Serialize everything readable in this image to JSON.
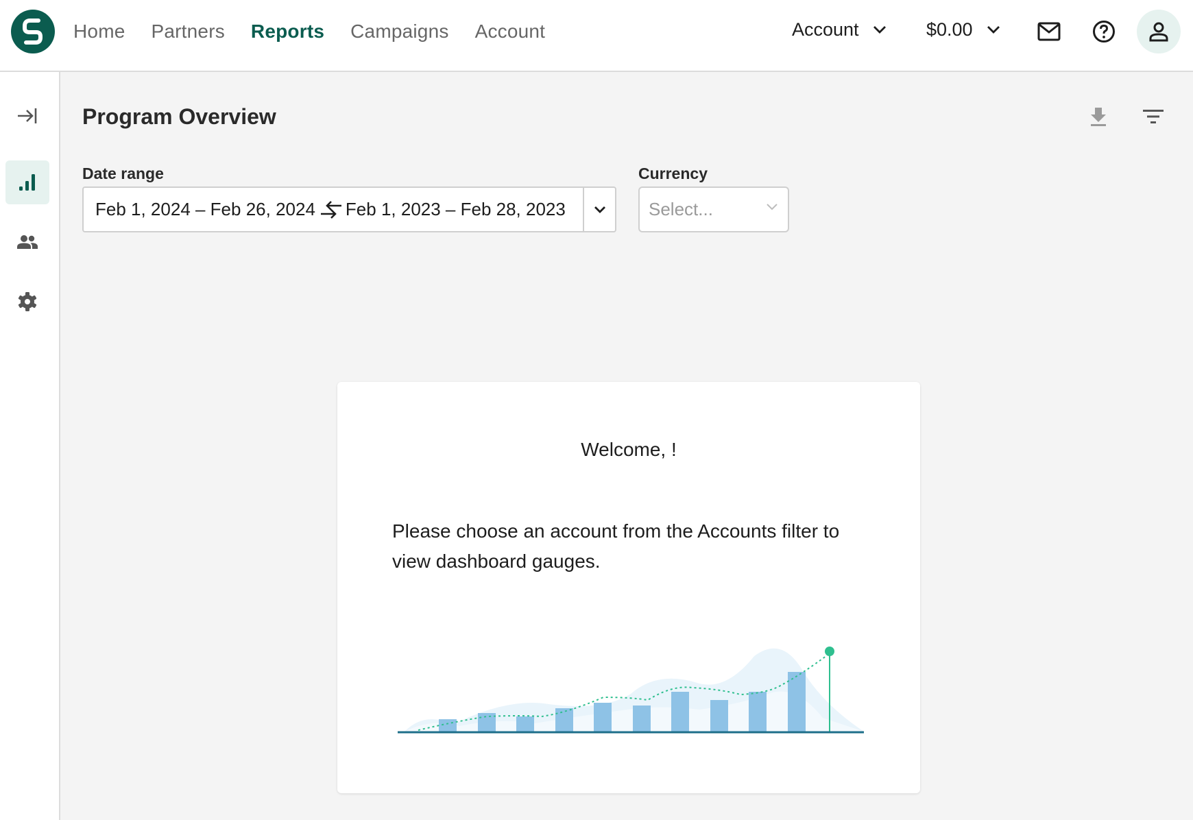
{
  "header": {
    "nav": [
      {
        "label": "Home",
        "active": false
      },
      {
        "label": "Partners",
        "active": false
      },
      {
        "label": "Reports",
        "active": true
      },
      {
        "label": "Campaigns",
        "active": false
      },
      {
        "label": "Account",
        "active": false
      }
    ],
    "account_dropdown": "Account",
    "balance_dropdown": "$0.00"
  },
  "sidebar": {
    "items": [
      {
        "icon": "collapse-sidebar-icon",
        "active": false
      },
      {
        "icon": "bar-chart-icon",
        "active": true
      },
      {
        "icon": "people-icon",
        "active": false
      },
      {
        "icon": "gear-icon",
        "active": false
      }
    ]
  },
  "main": {
    "title": "Program Overview",
    "date_range": {
      "label": "Date range",
      "primary": "Feb 1, 2024 – Feb 26, 2024",
      "comparison": "Feb 1, 2023 – Feb 28, 2023"
    },
    "currency": {
      "label": "Currency",
      "placeholder": "Select..."
    }
  },
  "card": {
    "welcome": "Welcome, !",
    "message": "Please choose an account from the Accounts filter to view dashboard gauges."
  },
  "colors": {
    "brand": "#0b5c4f",
    "bar": "#8ec2e6",
    "accent": "#2fbf8f"
  }
}
